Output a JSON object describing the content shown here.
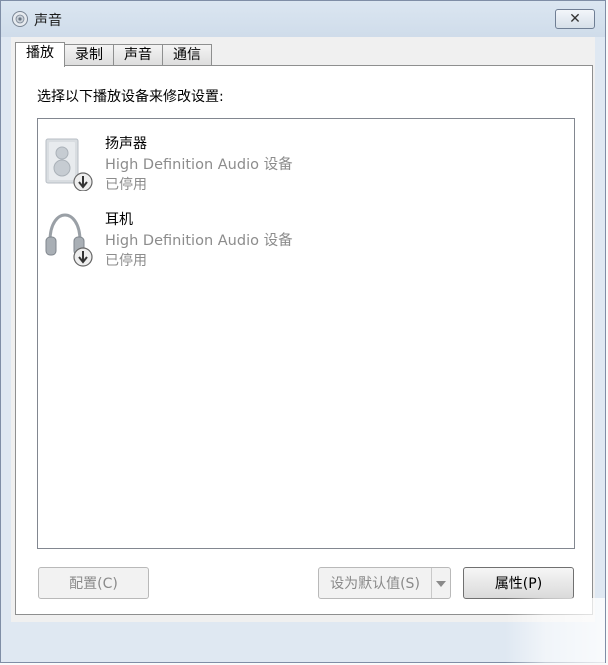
{
  "window": {
    "title": "声音",
    "icon": "speaker-icon",
    "close_glyph": "✕"
  },
  "tabs": [
    {
      "label": "播放",
      "active": true
    },
    {
      "label": "录制",
      "active": false
    },
    {
      "label": "声音",
      "active": false
    },
    {
      "label": "通信",
      "active": false
    }
  ],
  "playback": {
    "prompt": "选择以下播放设备来修改设置:",
    "devices": [
      {
        "name": "扬声器",
        "driver": "High Definition Audio 设备",
        "status": "已停用",
        "icon": "speaker-device-icon"
      },
      {
        "name": "耳机",
        "driver": "High Definition Audio 设备",
        "status": "已停用",
        "icon": "headphones-device-icon"
      }
    ]
  },
  "buttons": {
    "configure": "配置(C)",
    "set_default": "设为默认值(S)",
    "properties": "属性(P)"
  },
  "colors": {
    "disabled_text": "#8c8c8c",
    "window_border": "#7f8ea6"
  }
}
